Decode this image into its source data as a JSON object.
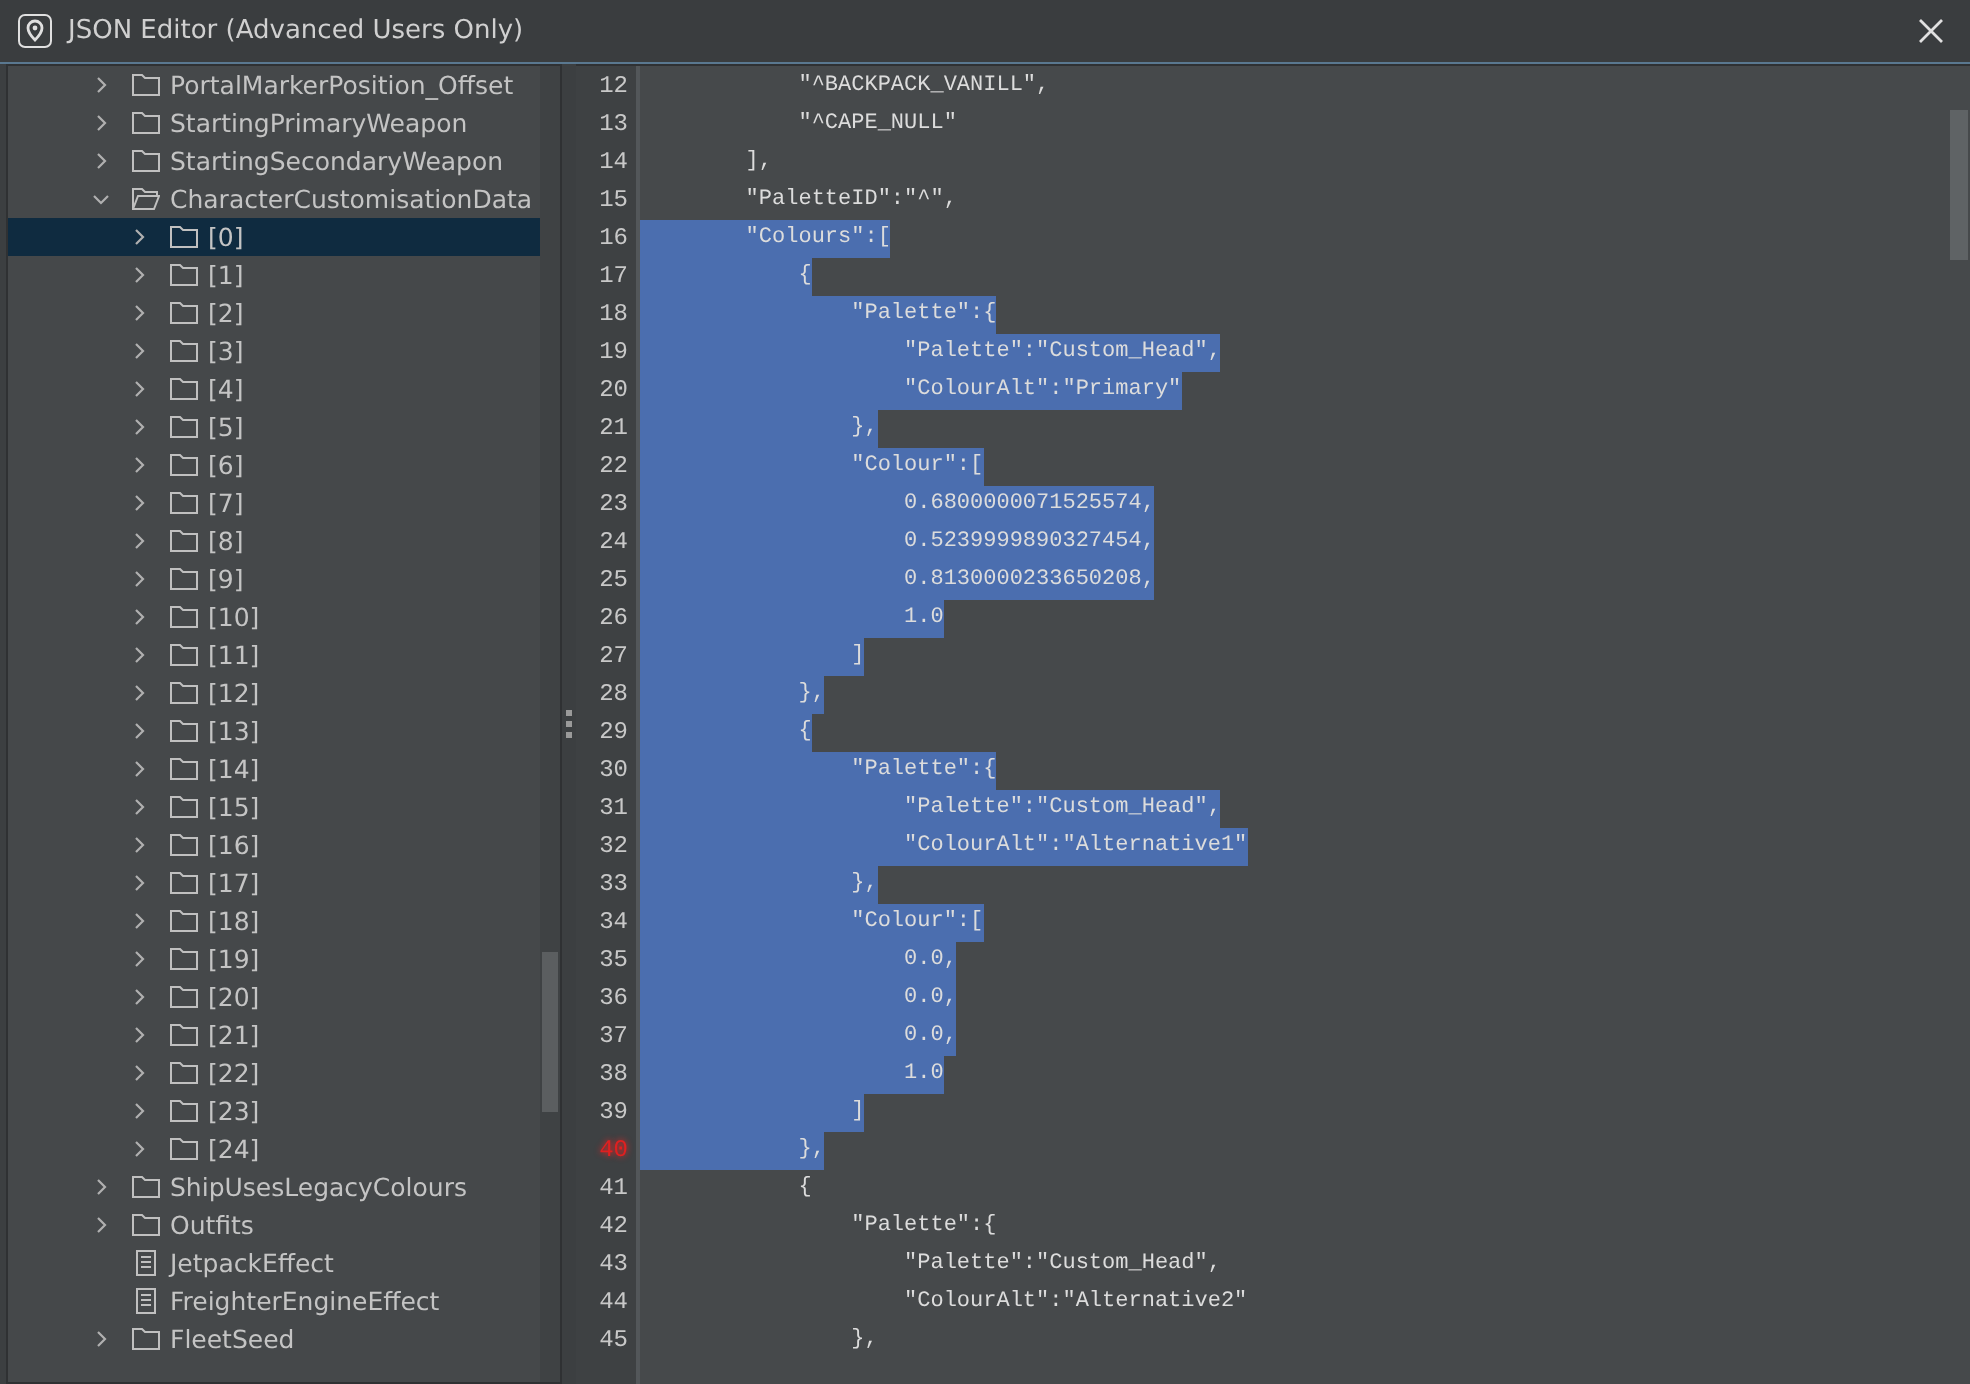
{
  "window": {
    "title": "JSON Editor (Advanced Users Only)"
  },
  "tree": [
    {
      "label": "PortalMarkerPosition_Offset",
      "kind": "folder",
      "expanded": false,
      "selected": false
    },
    {
      "label": "StartingPrimaryWeapon",
      "kind": "folder",
      "expanded": false,
      "selected": false
    },
    {
      "label": "StartingSecondaryWeapon",
      "kind": "folder",
      "expanded": false,
      "selected": false
    },
    {
      "label": "CharacterCustomisationData",
      "kind": "folder",
      "expanded": true,
      "selected": false,
      "children": [
        {
          "label": "[0]",
          "kind": "folder",
          "expanded": false,
          "selected": true
        },
        {
          "label": "[1]",
          "kind": "folder",
          "expanded": false,
          "selected": false
        },
        {
          "label": "[2]",
          "kind": "folder",
          "expanded": false,
          "selected": false
        },
        {
          "label": "[3]",
          "kind": "folder",
          "expanded": false,
          "selected": false
        },
        {
          "label": "[4]",
          "kind": "folder",
          "expanded": false,
          "selected": false
        },
        {
          "label": "[5]",
          "kind": "folder",
          "expanded": false,
          "selected": false
        },
        {
          "label": "[6]",
          "kind": "folder",
          "expanded": false,
          "selected": false
        },
        {
          "label": "[7]",
          "kind": "folder",
          "expanded": false,
          "selected": false
        },
        {
          "label": "[8]",
          "kind": "folder",
          "expanded": false,
          "selected": false
        },
        {
          "label": "[9]",
          "kind": "folder",
          "expanded": false,
          "selected": false
        },
        {
          "label": "[10]",
          "kind": "folder",
          "expanded": false,
          "selected": false
        },
        {
          "label": "[11]",
          "kind": "folder",
          "expanded": false,
          "selected": false
        },
        {
          "label": "[12]",
          "kind": "folder",
          "expanded": false,
          "selected": false
        },
        {
          "label": "[13]",
          "kind": "folder",
          "expanded": false,
          "selected": false
        },
        {
          "label": "[14]",
          "kind": "folder",
          "expanded": false,
          "selected": false
        },
        {
          "label": "[15]",
          "kind": "folder",
          "expanded": false,
          "selected": false
        },
        {
          "label": "[16]",
          "kind": "folder",
          "expanded": false,
          "selected": false
        },
        {
          "label": "[17]",
          "kind": "folder",
          "expanded": false,
          "selected": false
        },
        {
          "label": "[18]",
          "kind": "folder",
          "expanded": false,
          "selected": false
        },
        {
          "label": "[19]",
          "kind": "folder",
          "expanded": false,
          "selected": false
        },
        {
          "label": "[20]",
          "kind": "folder",
          "expanded": false,
          "selected": false
        },
        {
          "label": "[21]",
          "kind": "folder",
          "expanded": false,
          "selected": false
        },
        {
          "label": "[22]",
          "kind": "folder",
          "expanded": false,
          "selected": false
        },
        {
          "label": "[23]",
          "kind": "folder",
          "expanded": false,
          "selected": false
        },
        {
          "label": "[24]",
          "kind": "folder",
          "expanded": false,
          "selected": false
        }
      ]
    },
    {
      "label": "ShipUsesLegacyColours",
      "kind": "folder",
      "expanded": false,
      "selected": false
    },
    {
      "label": "Outfits",
      "kind": "folder",
      "expanded": false,
      "selected": false
    },
    {
      "label": "JetpackEffect",
      "kind": "leaf",
      "selected": false
    },
    {
      "label": "FreighterEngineEffect",
      "kind": "leaf",
      "selected": false
    },
    {
      "label": "FleetSeed",
      "kind": "folder",
      "expanded": false,
      "selected": false
    }
  ],
  "editor": {
    "lines": [
      {
        "number": "12",
        "text": "            \"^BACKPACK_VANILL\",",
        "selected": false,
        "marked": false
      },
      {
        "number": "13",
        "text": "            \"^CAPE_NULL\"",
        "selected": false,
        "marked": false
      },
      {
        "number": "14",
        "text": "        ],",
        "selected": false,
        "marked": false
      },
      {
        "number": "15",
        "text": "        \"PaletteID\":\"^\",",
        "selected": false,
        "marked": false
      },
      {
        "number": "16",
        "text": "        \"Colours\":[",
        "selected": true,
        "marked": false
      },
      {
        "number": "17",
        "text": "            {",
        "selected": true,
        "marked": false
      },
      {
        "number": "18",
        "text": "                \"Palette\":{",
        "selected": true,
        "marked": false
      },
      {
        "number": "19",
        "text": "                    \"Palette\":\"Custom_Head\",",
        "selected": true,
        "marked": false
      },
      {
        "number": "20",
        "text": "                    \"ColourAlt\":\"Primary\"",
        "selected": true,
        "marked": false
      },
      {
        "number": "21",
        "text": "                },",
        "selected": true,
        "marked": false
      },
      {
        "number": "22",
        "text": "                \"Colour\":[",
        "selected": true,
        "marked": false
      },
      {
        "number": "23",
        "text": "                    0.6800000071525574,",
        "selected": true,
        "marked": false
      },
      {
        "number": "24",
        "text": "                    0.5239999890327454,",
        "selected": true,
        "marked": false
      },
      {
        "number": "25",
        "text": "                    0.8130000233650208,",
        "selected": true,
        "marked": false
      },
      {
        "number": "26",
        "text": "                    1.0",
        "selected": true,
        "marked": false
      },
      {
        "number": "27",
        "text": "                ]",
        "selected": true,
        "marked": false
      },
      {
        "number": "28",
        "text": "            },",
        "selected": true,
        "marked": false
      },
      {
        "number": "29",
        "text": "            {",
        "selected": true,
        "marked": false
      },
      {
        "number": "30",
        "text": "                \"Palette\":{",
        "selected": true,
        "marked": false
      },
      {
        "number": "31",
        "text": "                    \"Palette\":\"Custom_Head\",",
        "selected": true,
        "marked": false
      },
      {
        "number": "32",
        "text": "                    \"ColourAlt\":\"Alternative1\"",
        "selected": true,
        "marked": false
      },
      {
        "number": "33",
        "text": "                },",
        "selected": true,
        "marked": false
      },
      {
        "number": "34",
        "text": "                \"Colour\":[",
        "selected": true,
        "marked": false
      },
      {
        "number": "35",
        "text": "                    0.0,",
        "selected": true,
        "marked": false
      },
      {
        "number": "36",
        "text": "                    0.0,",
        "selected": true,
        "marked": false
      },
      {
        "number": "37",
        "text": "                    0.0,",
        "selected": true,
        "marked": false
      },
      {
        "number": "38",
        "text": "                    1.0",
        "selected": true,
        "marked": false
      },
      {
        "number": "39",
        "text": "                ]",
        "selected": true,
        "marked": false
      },
      {
        "number": "40",
        "text": "            },",
        "selected": true,
        "marked": true
      },
      {
        "number": "41",
        "text": "            {",
        "selected": false,
        "marked": false
      },
      {
        "number": "42",
        "text": "                \"Palette\":{",
        "selected": false,
        "marked": false
      },
      {
        "number": "43",
        "text": "                    \"Palette\":\"Custom_Head\",",
        "selected": false,
        "marked": false
      },
      {
        "number": "44",
        "text": "                    \"ColourAlt\":\"Alternative2\"",
        "selected": false,
        "marked": false
      },
      {
        "number": "45",
        "text": "                },",
        "selected": false,
        "marked": false
      }
    ]
  }
}
